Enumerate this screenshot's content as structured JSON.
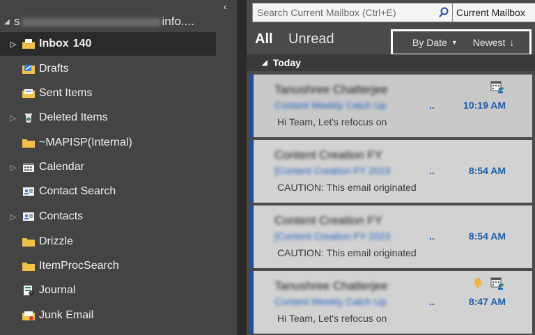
{
  "folder_pane": {
    "collapse_glyph": "‹",
    "account": {
      "prefix": "s",
      "suffix": "info...."
    },
    "folders": [
      {
        "label": "Inbox",
        "count": "140",
        "icon": "inbox-icon",
        "expandable": true,
        "selected": true
      },
      {
        "label": "Drafts",
        "icon": "drafts-icon",
        "expandable": false
      },
      {
        "label": "Sent Items",
        "icon": "sent-items-icon",
        "expandable": false
      },
      {
        "label": "Deleted Items",
        "icon": "deleted-items-icon",
        "expandable": true
      },
      {
        "label": "~MAPISP(Internal)",
        "icon": "folder-icon",
        "expandable": false
      },
      {
        "label": "Calendar",
        "icon": "calendar-icon",
        "expandable": true
      },
      {
        "label": "Contact Search",
        "icon": "contact-card-icon",
        "expandable": false
      },
      {
        "label": "Contacts",
        "icon": "contact-card-icon",
        "expandable": true
      },
      {
        "label": "Drizzle",
        "icon": "folder-icon",
        "expandable": false
      },
      {
        "label": "ItemProcSearch",
        "icon": "folder-icon",
        "expandable": false
      },
      {
        "label": "Journal",
        "icon": "journal-icon",
        "expandable": false
      },
      {
        "label": "Junk Email",
        "icon": "junk-email-icon",
        "expandable": false
      }
    ]
  },
  "list_pane": {
    "search": {
      "placeholder": "Search Current Mailbox (Ctrl+E)",
      "scope": "Current Mailbox"
    },
    "filters": {
      "all": "All",
      "unread": "Unread"
    },
    "sort": {
      "by": "By Date",
      "order": "Newest"
    },
    "group": {
      "label": "Today"
    },
    "messages": [
      {
        "sender": "Tanushree Chatterjee",
        "subject": "Content Weekly Catch Up",
        "dots": "..",
        "time": "10:19 AM",
        "preview": "Hi Team,  Let's refocus on",
        "icons": [
          "calendar-meeting-icon"
        ]
      },
      {
        "sender": "Content Creation FY",
        "subject": "[Content Creation FY 2023",
        "dots": "..",
        "time": "8:54 AM",
        "preview": "CAUTION: This email originated",
        "icons": []
      },
      {
        "sender": "Content Creation FY",
        "subject": "[Content Creation FY 2023",
        "dots": "..",
        "time": "8:54 AM",
        "preview": "CAUTION: This email originated",
        "icons": []
      },
      {
        "sender": "Tanushree Chatterjee",
        "subject": "Content Weekly Catch Up",
        "dots": "..",
        "time": "8:47 AM",
        "preview": "Hi Team,  Let's refocus on",
        "icons": [
          "reminder-bell-icon",
          "calendar-meeting-icon"
        ]
      }
    ]
  },
  "colors": {
    "folder_pane_bg": "#444444",
    "selected_folder_bg": "#2a2a2a",
    "list_pane_bg": "#4a4a4a",
    "message_bg": "#d2d2d2",
    "unread_bar": "#1f4e9c",
    "time_text": "#1e5ea8",
    "folder_yellow": "#f0c24b"
  }
}
